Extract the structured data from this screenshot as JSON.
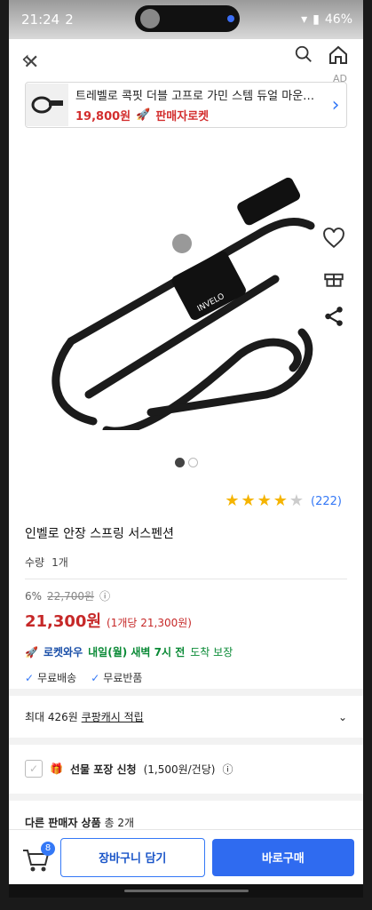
{
  "status": {
    "time": "21:24",
    "extra": "2",
    "battery": "46%"
  },
  "ad": {
    "tag": "AD",
    "title": "트레벨로 콕핏 더블 고프로 가민 스템 듀얼 마운트 ...",
    "price": "19,800원",
    "badge": "판매자로켓"
  },
  "product": {
    "rating_count": "(222)",
    "name": "인벨로 안장 스프링 서스펜션",
    "qty_label": "수량",
    "qty_value": "1개",
    "discount": "6%",
    "original_price": "22,700원",
    "price": "21,300원",
    "unit_price": "(1개당 21,300원)",
    "rocket_label": "로켓와우",
    "delivery_day": "내일(월) 새벽 7시 전",
    "delivery_tail": "도착 보장",
    "free_shipping": "무료배송",
    "free_return": "무료반품"
  },
  "cash": {
    "prefix": "최대 426원",
    "link": "쿠팡캐시 적립"
  },
  "gift": {
    "label": "선물 포장 신청",
    "price": "(1,500원/건당)"
  },
  "other": {
    "label": "다른 판매자 상품",
    "count": "총 2개"
  },
  "bottom": {
    "cart_count": "8",
    "cart_button": "장바구니 담기",
    "buy_button": "바로구매"
  }
}
